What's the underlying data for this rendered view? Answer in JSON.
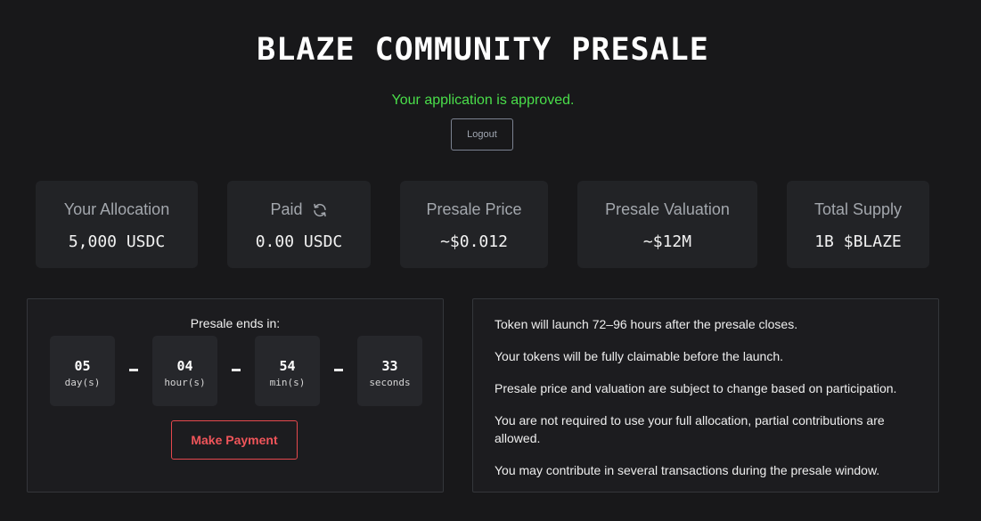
{
  "header": {
    "title": "BLAZE COMMUNITY PRESALE",
    "status_message": "Your application is approved.",
    "status_color": "#4ade4a",
    "logout_label": "Logout"
  },
  "stats": {
    "allocation": {
      "label": "Your Allocation",
      "value": "5,000 USDC"
    },
    "paid": {
      "label": "Paid",
      "value": "0.00 USDC",
      "icon": "refresh-icon"
    },
    "price": {
      "label": "Presale Price",
      "value": "~$0.012"
    },
    "valuation": {
      "label": "Presale Valuation",
      "value": "~$12M"
    },
    "supply": {
      "label": "Total Supply",
      "value": "1B $BLAZE"
    }
  },
  "countdown": {
    "label": "Presale ends in:",
    "units": [
      {
        "value": "05",
        "unit": "day(s)"
      },
      {
        "value": "04",
        "unit": "hour(s)"
      },
      {
        "value": "54",
        "unit": "min(s)"
      },
      {
        "value": "33",
        "unit": "seconds"
      }
    ],
    "pay_label": "Make Payment",
    "pay_color": "#e5484d"
  },
  "info": {
    "items": [
      "Token will launch 72–96 hours after the presale closes.",
      "Your tokens will be fully claimable before the launch.",
      "Presale price and valuation are subject to change based on participation.",
      "You are not required to use your full allocation, partial contributions are allowed.",
      "You may contribute in several transactions during the presale window."
    ]
  }
}
